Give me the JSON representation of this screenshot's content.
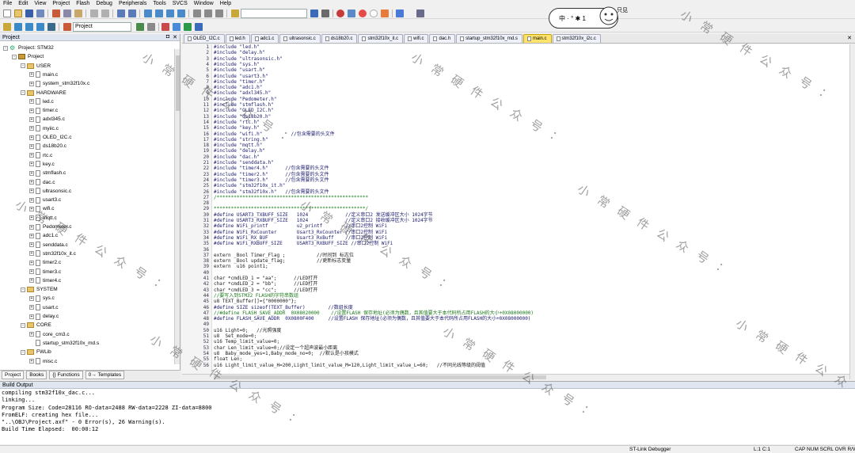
{
  "menu": [
    "File",
    "Edit",
    "View",
    "Project",
    "Flash",
    "Debug",
    "Peripherals",
    "Tools",
    "SVCS",
    "Window",
    "Help"
  ],
  "toolbar": {
    "target_select": "Project"
  },
  "ime": {
    "label": "中 · ° ✱ 1",
    "badge": "只见"
  },
  "project_panel": {
    "title": "Project",
    "tree": [
      {
        "label": "Project: STM32",
        "kind": "proj",
        "level": 0,
        "toggle": "-"
      },
      {
        "label": "Project",
        "kind": "target",
        "level": 1,
        "toggle": "-"
      },
      {
        "label": "USER",
        "kind": "folder",
        "level": 2,
        "toggle": "-"
      },
      {
        "label": "main.c",
        "kind": "file",
        "level": 3,
        "toggle": "+"
      },
      {
        "label": "system_stm32f10x.c",
        "kind": "file",
        "level": 3,
        "toggle": "+"
      },
      {
        "label": "HARDWARE",
        "kind": "folder",
        "level": 2,
        "toggle": "-"
      },
      {
        "label": "led.c",
        "kind": "file",
        "level": 3,
        "toggle": "+"
      },
      {
        "label": "timer.c",
        "kind": "file",
        "level": 3,
        "toggle": "+"
      },
      {
        "label": "adxl345.c",
        "kind": "file",
        "level": 3,
        "toggle": "+"
      },
      {
        "label": "myiic.c",
        "kind": "file",
        "level": 3,
        "toggle": "+"
      },
      {
        "label": "OLED_I2C.c",
        "kind": "file",
        "level": 3,
        "toggle": "+"
      },
      {
        "label": "ds18b20.c",
        "kind": "file",
        "level": 3,
        "toggle": "+"
      },
      {
        "label": "rtc.c",
        "kind": "file",
        "level": 3,
        "toggle": "+"
      },
      {
        "label": "key.c",
        "kind": "file",
        "level": 3,
        "toggle": "+"
      },
      {
        "label": "stmflash.c",
        "kind": "file",
        "level": 3,
        "toggle": "+"
      },
      {
        "label": "dac.c",
        "kind": "file",
        "level": 3,
        "toggle": "+"
      },
      {
        "label": "ultrasonsic.c",
        "kind": "file",
        "level": 3,
        "toggle": "+"
      },
      {
        "label": "usart3.c",
        "kind": "file",
        "level": 3,
        "toggle": "+"
      },
      {
        "label": "wifi.c",
        "kind": "file",
        "level": 3,
        "toggle": "+"
      },
      {
        "label": "mqtt.c",
        "kind": "file",
        "level": 3,
        "toggle": "+"
      },
      {
        "label": "Pedometer.c",
        "kind": "file",
        "level": 3,
        "toggle": "+"
      },
      {
        "label": "adc1.c",
        "kind": "file",
        "level": 3,
        "toggle": "+"
      },
      {
        "label": "senddata.c",
        "kind": "file",
        "level": 3,
        "toggle": "+"
      },
      {
        "label": "stm32f10x_it.c",
        "kind": "file",
        "level": 3,
        "toggle": "+"
      },
      {
        "label": "timer2.c",
        "kind": "file",
        "level": 3,
        "toggle": "+"
      },
      {
        "label": "timer3.c",
        "kind": "file",
        "level": 3,
        "toggle": "+"
      },
      {
        "label": "timer4.c",
        "kind": "file",
        "level": 3,
        "toggle": "+"
      },
      {
        "label": "SYSTEM",
        "kind": "folder",
        "level": 2,
        "toggle": "-"
      },
      {
        "label": "sys.c",
        "kind": "file",
        "level": 3,
        "toggle": "+"
      },
      {
        "label": "usart.c",
        "kind": "file",
        "level": 3,
        "toggle": "+"
      },
      {
        "label": "delay.c",
        "kind": "file",
        "level": 3,
        "toggle": "+"
      },
      {
        "label": "CORE",
        "kind": "folder",
        "level": 2,
        "toggle": "-"
      },
      {
        "label": "core_cm3.c",
        "kind": "file",
        "level": 3,
        "toggle": "+"
      },
      {
        "label": "startup_stm32f10x_md.s",
        "kind": "file",
        "level": 3,
        "toggle": ""
      },
      {
        "label": "FWLib",
        "kind": "folder",
        "level": 2,
        "toggle": "-"
      },
      {
        "label": "misc.c",
        "kind": "file",
        "level": 3,
        "toggle": "+"
      }
    ],
    "tabs": [
      "Project",
      "Books",
      "{} Functions",
      "0→ Templates"
    ]
  },
  "editor_tabs": [
    "OLED_I2C.c",
    "led.h",
    "adc1.c",
    "ultrasonsic.c",
    "ds18b20.c",
    "stm32f10x_it.c",
    "wifi.c",
    "dac.h",
    "startup_stm32f10x_md.s",
    "main.c",
    "stm32f10x_i2c.c"
  ],
  "active_tab": "main.c",
  "code_lines": [
    {
      "n": "1",
      "t": "#include \"led.h\""
    },
    {
      "n": "2",
      "t": "#include \"delay.h\""
    },
    {
      "n": "3",
      "t": "#include \"ultrasonsic.h\""
    },
    {
      "n": "4",
      "t": "#include \"sys.h\""
    },
    {
      "n": "5",
      "t": "#include \"usart.h\""
    },
    {
      "n": "6",
      "t": "#include \"usart3.h\""
    },
    {
      "n": "7",
      "t": "#include \"timer.h\""
    },
    {
      "n": "8",
      "t": "#include \"adc1.h\""
    },
    {
      "n": "9",
      "t": "#include \"adxl345.h\""
    },
    {
      "n": "10",
      "t": "#include \"Pedometer.h\""
    },
    {
      "n": "11",
      "t": "#include \"stmflash.h\""
    },
    {
      "n": "12",
      "t": "#include \"OLED_I2C.h\""
    },
    {
      "n": "13",
      "t": "#include \"ds18b20.h\""
    },
    {
      "n": "14",
      "t": "#include \"rtc.h\""
    },
    {
      "n": "15",
      "t": "#include \"key.h\""
    },
    {
      "n": "16",
      "t": "#include \"wifi.h\"          //包含需要的头文件"
    },
    {
      "n": "17",
      "t": "#include \"string.h\""
    },
    {
      "n": "18",
      "t": "#include \"mqtt.h\""
    },
    {
      "n": "19",
      "t": "#include \"delay.h\""
    },
    {
      "n": "20",
      "t": "#include \"dac.h\""
    },
    {
      "n": "21",
      "t": "#include \"senddata.h\""
    },
    {
      "n": "22",
      "t": "#include \"timer4.h\"      //包含需要的头文件"
    },
    {
      "n": "23",
      "t": "#include \"timer2.h\"      //包含需要的头文件"
    },
    {
      "n": "24",
      "t": "#include \"timer3.h\"      //包含需要的头文件"
    },
    {
      "n": "25",
      "t": "#include \"stm32f10x_it.h\""
    },
    {
      "n": "26",
      "t": "#include \"stm32f10x.h\"   //包含需要的头文件"
    },
    {
      "n": "27",
      "t": "/*****************************************************"
    },
    {
      "n": "28",
      "t": ""
    },
    {
      "n": "29",
      "t": "*****************************************************/"
    },
    {
      "n": "30",
      "t": "#define USART3_TXBUFF_SIZE   1024             //定义串口2 发送缓冲区大小 1024字节"
    },
    {
      "n": "31",
      "t": "#define USART3_RXBUFF_SIZE   1024             //定义串口2 接收缓冲区大小 1024字节"
    },
    {
      "n": "32",
      "t": "#define WiFi_printf          u2_printf        //串口2控制 WiFi"
    },
    {
      "n": "33",
      "t": "#define WiFi_RxCounter       Usart3_RxCounter //串口2控制 WiFi"
    },
    {
      "n": "34",
      "t": "#define WiFi_RX_BUF          Usart3_RxBuff    //串口2控制 WiFi"
    },
    {
      "n": "35",
      "t": "#define WiFi_RXBUFF_SIZE     USART3_RXBUFF_SIZE //串口2控制 WiFi"
    },
    {
      "n": "36",
      "t": ""
    },
    {
      "n": "37",
      "t": "extern _Bool Timer_Flag ;           //时间到 标志位"
    },
    {
      "n": "38",
      "t": "extern _Bool update_flag;           //更新标志变量"
    },
    {
      "n": "39",
      "t": "extern  u16 point1;"
    },
    {
      "n": "40",
      "t": ""
    },
    {
      "n": "41",
      "t": "char *cmdLED_1 = \"aa\";      //LED打开"
    },
    {
      "n": "42",
      "t": "char *cmdLED_2 = \"bb\";      //LED打开"
    },
    {
      "n": "43",
      "t": "char *cmdLED_3 = \"cc\";      //LED打开"
    },
    {
      "n": "44",
      "t": "//要写入到STM32 FLASH的字符串数组"
    },
    {
      "n": "45",
      "t": "u8 TEXT_Buffer[]={\"0000000\"};"
    },
    {
      "n": "46",
      "t": "#define SIZE sizeof(TEXT_Buffer)        //数组长度"
    },
    {
      "n": "47",
      "t": "//#define FLASH_SAVE_ADDR  0X08020000    //设置FLASH 保存地址(必须为偶数，且其值要大于本代码所占用FLASH的大小+0X08000000)"
    },
    {
      "n": "48",
      "t": "#define FLASH_SAVE_ADDR  0X0800F400     //设置FLASH 保存地址(必须为偶数，且其值要大于本代码所占用FLASH的大小+0X08000000)"
    },
    {
      "n": "49",
      "t": ""
    },
    {
      "n": "50",
      "t": "u16 Light=0;   //光照强度"
    },
    {
      "n": "51",
      "t": "u8  Set_mode=0;"
    },
    {
      "n": "52",
      "t": "u16 Temp_limit_value=0;"
    },
    {
      "n": "53",
      "t": "char Len_limit_value=0;//设定一个超声波最小距离"
    },
    {
      "n": "54",
      "t": "u8  Baby_mode_yes=1,Baby_mode_no=0;  //默认是小孩模式"
    },
    {
      "n": "55",
      "t": "float Len;"
    },
    {
      "n": "56",
      "t": "u16 Light_limit_value_H=200,Light_limit_value_M=120,Light_limit_value_L=60;   //不同光线等级的阈值"
    }
  ],
  "build_output": {
    "title": "Build Output",
    "lines": [
      "compiling stm32f10x_dac.c...",
      "linking...",
      "Program Size: Code=28116 RO-data=2488 RW-data=2228 ZI-data=8800",
      "FromELF: creating hex file...",
      "\"..\\OBJ\\Project.axf\" - 0 Error(s), 26 Warning(s).",
      "Build Time Elapsed:  00:00:12"
    ]
  },
  "status": {
    "debugger": "ST-Link Debugger",
    "position": "L:1 C:1",
    "indicators": "CAP  NUM  SCRL  OVR  R/W"
  },
  "watermark": [
    "小",
    "常",
    "硬",
    "件",
    "公",
    "众",
    "号",
    "："
  ]
}
